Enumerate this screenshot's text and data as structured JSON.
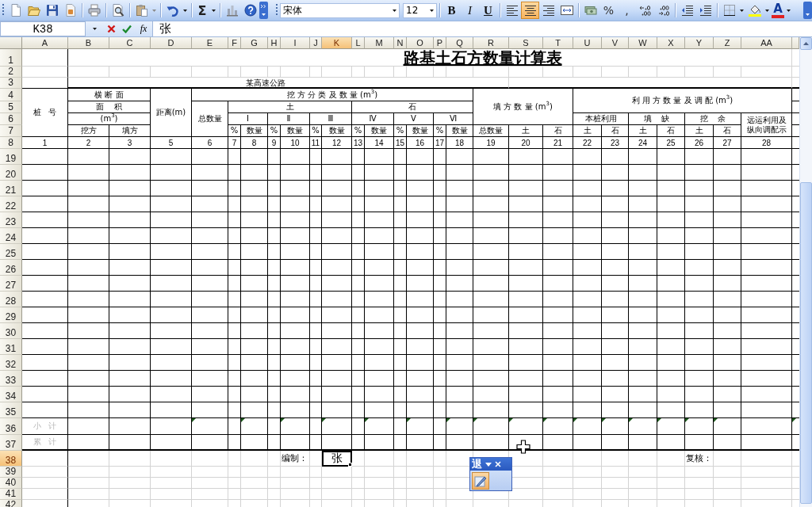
{
  "toolbar": {
    "autosum": "Σ",
    "font_name": "宋体",
    "font_size": "12",
    "style_buttons": [
      {
        "label": "B",
        "selected": false
      },
      {
        "label": "I",
        "selected": false
      },
      {
        "label": "U",
        "selected": false
      }
    ],
    "alignment_buttons": [
      {
        "kind": "left",
        "selected": false
      },
      {
        "kind": "center",
        "selected": true
      },
      {
        "kind": "right",
        "selected": false
      }
    ],
    "number_buttons": [
      "%",
      ","
    ],
    "font_color_label": "A"
  },
  "formula_bar": {
    "name_box": "K38",
    "function_label": "fx",
    "value": "张"
  },
  "columns": [
    {
      "label": "A",
      "selected": false
    },
    {
      "label": "B",
      "selected": false
    },
    {
      "label": "C",
      "selected": false
    },
    {
      "label": "D",
      "selected": false
    },
    {
      "label": "E",
      "selected": false
    },
    {
      "label": "F",
      "selected": false
    },
    {
      "label": "G",
      "selected": false
    },
    {
      "label": "H",
      "selected": false
    },
    {
      "label": "I",
      "selected": false
    },
    {
      "label": "J",
      "selected": false
    },
    {
      "label": "K",
      "selected": true
    },
    {
      "label": "L",
      "selected": false
    },
    {
      "label": "M",
      "selected": false
    },
    {
      "label": "N",
      "selected": false
    },
    {
      "label": "O",
      "selected": false
    },
    {
      "label": "P",
      "selected": false
    },
    {
      "label": "Q",
      "selected": false
    },
    {
      "label": "R",
      "selected": false
    },
    {
      "label": "S",
      "selected": false
    },
    {
      "label": "T",
      "selected": false
    },
    {
      "label": "U",
      "selected": false
    },
    {
      "label": "V",
      "selected": false
    },
    {
      "label": "W",
      "selected": false
    },
    {
      "label": "X",
      "selected": false
    },
    {
      "label": "Y",
      "selected": false
    },
    {
      "label": "Z",
      "selected": false
    },
    {
      "label": "AA",
      "selected": false
    }
  ],
  "rows": [
    {
      "label": "1",
      "selected": false
    },
    {
      "label": "2",
      "selected": false
    },
    {
      "label": "3",
      "selected": false
    },
    {
      "label": "4",
      "selected": false
    },
    {
      "label": "5",
      "selected": false
    },
    {
      "label": "6",
      "selected": false
    },
    {
      "label": "7",
      "selected": false
    },
    {
      "label": "8",
      "selected": false
    },
    {
      "label": "19",
      "selected": false
    },
    {
      "label": "20",
      "selected": false
    },
    {
      "label": "21",
      "selected": false
    },
    {
      "label": "22",
      "selected": false
    },
    {
      "label": "23",
      "selected": false
    },
    {
      "label": "24",
      "selected": false
    },
    {
      "label": "25",
      "selected": false
    },
    {
      "label": "26",
      "selected": false
    },
    {
      "label": "27",
      "selected": false
    },
    {
      "label": "28",
      "selected": false
    },
    {
      "label": "29",
      "selected": false
    },
    {
      "label": "30",
      "selected": false
    },
    {
      "label": "31",
      "selected": false
    },
    {
      "label": "32",
      "selected": false
    },
    {
      "label": "33",
      "selected": false
    },
    {
      "label": "34",
      "selected": false
    },
    {
      "label": "35",
      "selected": false
    },
    {
      "label": "36",
      "selected": false
    },
    {
      "label": "37",
      "selected": false
    },
    {
      "label": "38",
      "selected": true
    },
    {
      "label": "39",
      "selected": false
    },
    {
      "label": "40",
      "selected": false
    },
    {
      "label": "41",
      "selected": false
    },
    {
      "label": "42",
      "selected": false
    }
  ],
  "sheet": {
    "title": "路基土石方数量计算表",
    "subtitle": "某高速公路",
    "header_rows": [
      [
        "桩   号",
        "横 断 面",
        "距离(m)",
        "挖 方 分 类 及 数 量 (m$^{3}$)",
        "填 方 数 量 (m$^{3}$)",
        "利 用 方 数 量 及 调 配 (m$^{3}$)"
      ],
      [
        "面    积",
        "总数量",
        "土",
        "石"
      ],
      [
        "(m$^{3}$)",
        "Ⅰ",
        "Ⅱ",
        "Ⅲ",
        "Ⅳ",
        "Ⅴ",
        "Ⅵ",
        "本桩利用",
        "填    缺",
        "挖    余",
        "远运利用及纵向调配示"
      ],
      [
        "挖方",
        "填方",
        "%",
        "数量",
        "%",
        "数量",
        "%",
        "数量",
        "%",
        "数量",
        "%",
        "数量",
        "%",
        "数量",
        "总数量",
        "土",
        "石",
        "土",
        "石",
        "土",
        "石",
        "土",
        "石"
      ]
    ],
    "column_numbers": [
      "1",
      "2",
      "3",
      "5",
      "6",
      "7",
      "8",
      "9",
      "10",
      "11",
      "12",
      "13",
      "14",
      "15",
      "16",
      "17",
      "18",
      "19",
      "20",
      "21",
      "22",
      "23",
      "24",
      "25",
      "26",
      "27",
      "28"
    ],
    "summary_rows": [
      {
        "label": "小   计",
        "cells": [
          {
            "flagged": false
          },
          {
            "flagged": false
          },
          {
            "flagged": false
          },
          {
            "flagged": true
          },
          {
            "flagged": false
          },
          {
            "flagged": true
          },
          {
            "flagged": false
          },
          {
            "flagged": true
          },
          {
            "flagged": false
          },
          {
            "flagged": true
          },
          {
            "flagged": false
          },
          {
            "flagged": true
          },
          {
            "flagged": false
          },
          {
            "flagged": true
          },
          {
            "flagged": false
          },
          {
            "flagged": true
          },
          {
            "flagged": true
          },
          {
            "flagged": true
          },
          {
            "flagged": true
          },
          {
            "flagged": true
          },
          {
            "flagged": true
          },
          {
            "flagged": true
          },
          {
            "flagged": true
          },
          {
            "flagged": true
          },
          {
            "flagged": true
          },
          {
            "flagged": false
          },
          {
            "flagged": true
          }
        ]
      },
      {
        "label": "累   计"
      }
    ],
    "signatures": [
      "编制：",
      "复核："
    ],
    "active_cell": {
      "text": "张"
    }
  },
  "floating_toolbar": {
    "title": "退"
  }
}
